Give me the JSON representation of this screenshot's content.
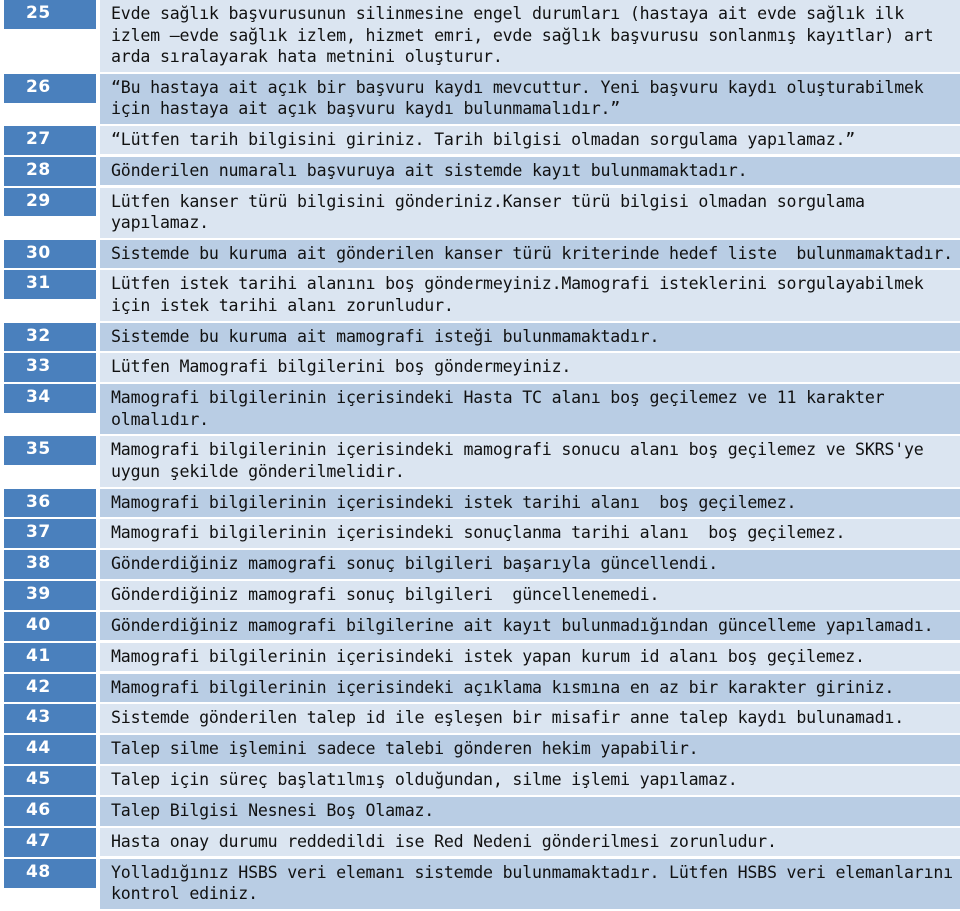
{
  "document": {
    "type": "error-code-table",
    "colors": {
      "code_cell_bg": "#4a80bd",
      "code_text": "#ffffff",
      "row_light_bg": "#dbe5f1",
      "row_dark_bg": "#b9cde4",
      "body_text": "#111111",
      "page_bg": "#ffffff"
    },
    "rows": [
      {
        "code": "25",
        "text": "Evde sağlık başvurusunun silinmesine engel durumları (hastaya ait evde sağlık ilk izlem –evde sağlık izlem, hizmet emri, evde sağlık başvurusu sonlanmış kayıtlar) art arda sıralayarak hata metnini oluşturur."
      },
      {
        "code": "26",
        "text": "“Bu hastaya ait açık bir başvuru kaydı mevcuttur. Yeni başvuru kaydı oluşturabilmek için hastaya ait açık başvuru kaydı bulunmamalıdır.”"
      },
      {
        "code": "27",
        "text": "“Lütfen tarih bilgisini giriniz. Tarih bilgisi olmadan sorgulama yapılamaz.”"
      },
      {
        "code": "28",
        "text": "Gönderilen numaralı başvuruya ait sistemde kayıt bulunmamaktadır."
      },
      {
        "code": "29",
        "text": "Lütfen kanser türü bilgisini gönderiniz.Kanser türü bilgisi olmadan sorgulama yapılamaz."
      },
      {
        "code": "30",
        "text": "Sistemde bu kuruma ait gönderilen kanser türü kriterinde hedef liste  bulunmamaktadır."
      },
      {
        "code": "31",
        "text": "Lütfen istek tarihi alanını boş göndermeyiniz.Mamografi isteklerini sorgulayabilmek için istek tarihi alanı zorunludur."
      },
      {
        "code": "32",
        "text": "Sistemde bu kuruma ait mamografi isteği bulunmamaktadır."
      },
      {
        "code": "33",
        "text": "Lütfen Mamografi bilgilerini boş göndermeyiniz."
      },
      {
        "code": "34",
        "text": "Mamografi bilgilerinin içerisindeki Hasta TC alanı boş geçilemez ve 11 karakter olmalıdır."
      },
      {
        "code": "35",
        "text": "Mamografi bilgilerinin içerisindeki mamografi sonucu alanı boş geçilemez ve SKRS'ye uygun şekilde gönderilmelidir."
      },
      {
        "code": "36",
        "text": "Mamografi bilgilerinin içerisindeki istek tarihi alanı  boş geçilemez."
      },
      {
        "code": "37",
        "text": "Mamografi bilgilerinin içerisindeki sonuçlanma tarihi alanı  boş geçilemez."
      },
      {
        "code": "38",
        "text": "Gönderdiğiniz mamografi sonuç bilgileri başarıyla güncellendi."
      },
      {
        "code": "39",
        "text": "Gönderdiğiniz mamografi sonuç bilgileri  güncellenemedi."
      },
      {
        "code": "40",
        "text": "Gönderdiğiniz mamografi bilgilerine ait kayıt bulunmadığından güncelleme yapılamadı."
      },
      {
        "code": "41",
        "text": "Mamografi bilgilerinin içerisindeki istek yapan kurum id alanı boş geçilemez."
      },
      {
        "code": "42",
        "text": "Mamografi bilgilerinin içerisindeki açıklama kısmına en az bir karakter giriniz."
      },
      {
        "code": "43",
        "text": "Sistemde gönderilen talep id ile eşleşen bir misafir anne talep kaydı bulunamadı."
      },
      {
        "code": "44",
        "text": "Talep silme işlemini sadece talebi gönderen hekim yapabilir."
      },
      {
        "code": "45",
        "text": "Talep için süreç başlatılmış olduğundan, silme işlemi yapılamaz."
      },
      {
        "code": "46",
        "text": "Talep Bilgisi Nesnesi Boş Olamaz."
      },
      {
        "code": "47",
        "text": "Hasta onay durumu reddedildi ise Red Nedeni gönderilmesi zorunludur."
      },
      {
        "code": "48",
        "text": "Yolladığınız HSBS veri elemanı sistemde bulunmamaktadır. Lütfen HSBS veri elemanlarını kontrol ediniz."
      }
    ]
  }
}
